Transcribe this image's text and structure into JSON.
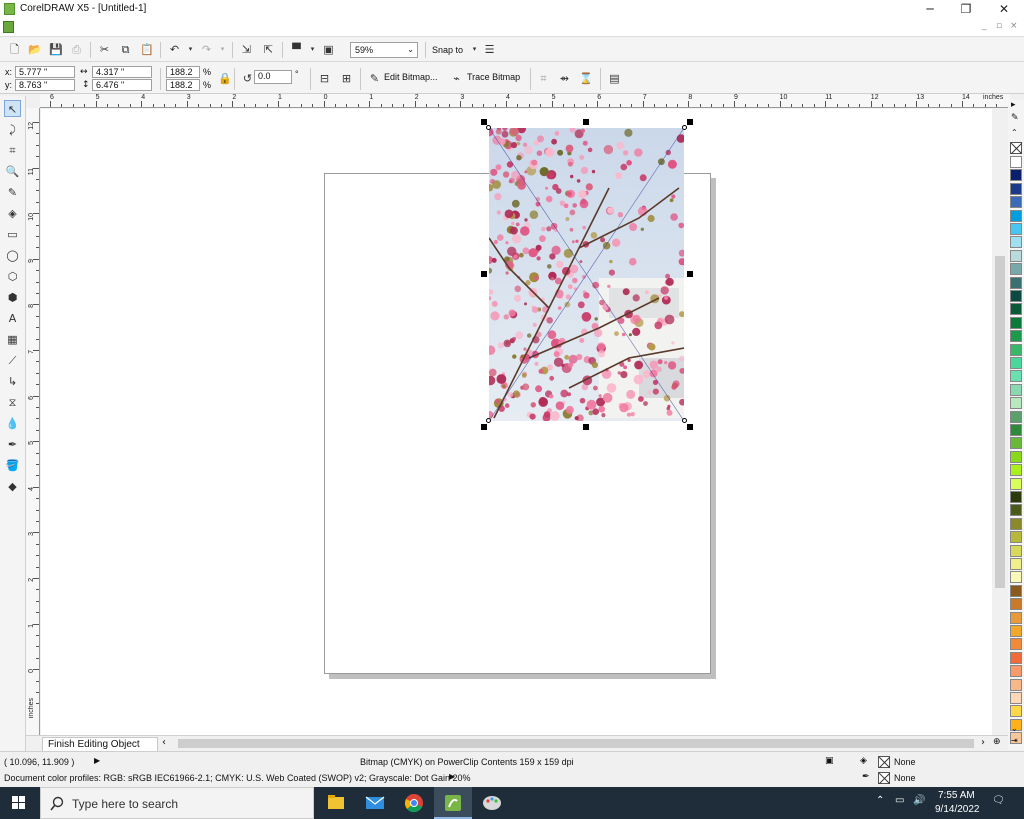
{
  "window": {
    "title": "CorelDRAW X5 - [Untitled-1]",
    "minimize_glyph": "─",
    "restore_glyph": "❐",
    "close_glyph": "✕"
  },
  "menubar": {
    "min_glyph": "_",
    "restore_glyph": "▫",
    "close_glyph": "×"
  },
  "toolbar": {
    "zoom_value": "59%",
    "snap_label": "Snap to"
  },
  "propbar": {
    "x_label": "x:",
    "x_value": "5.777 \"",
    "y_label": "y:",
    "y_value": "8.763 \"",
    "w_value": "4.317 \"",
    "h_value": "6.476 \"",
    "scale_w": "188.2",
    "scale_h": "188.2",
    "pct": "%",
    "rotation": "0.0",
    "deg": "°",
    "edit_bitmap_label": "Edit Bitmap...",
    "trace_bitmap_label": "Trace Bitmap"
  },
  "ruler": {
    "units": "inches",
    "h_labels": [
      "6",
      "5",
      "4",
      "3",
      "2",
      "1",
      "0",
      "1",
      "2",
      "3",
      "4",
      "5",
      "6",
      "7",
      "8",
      "9",
      "10",
      "11",
      "12",
      "13",
      "14"
    ],
    "v_labels": [
      "12",
      "11",
      "10",
      "9",
      "8",
      "7",
      "6",
      "5",
      "4",
      "3",
      "2",
      "1",
      "0"
    ],
    "v_units": "inches"
  },
  "doc_tab": {
    "label": "Finish Editing Object"
  },
  "status": {
    "coords": "( 10.096, 11.909 )",
    "object_info": "Bitmap (CMYK) on PowerClip Contents 159 x 159 dpi",
    "fill_none": "None",
    "outline_none": "None",
    "color_profiles": "Document color profiles: RGB: sRGB IEC61966-2.1; CMYK: U.S. Web Coated (SWOP) v2; Grayscale: Dot Gain 20%"
  },
  "palette_colors": [
    "#ffffff",
    "#0a1e6e",
    "#1a3a8a",
    "#3a6ab8",
    "#00a0e0",
    "#46c6f0",
    "#9ee0f0",
    "#b8dada",
    "#78a8a8",
    "#3a7070",
    "#0a4a40",
    "#0a5a3a",
    "#0a7a3a",
    "#1a9a4a",
    "#3ab86a",
    "#4ad89a",
    "#6ae0b0",
    "#8ad8b0",
    "#b8e8c0",
    "#5aa06a",
    "#2e8a3a",
    "#6ab83a",
    "#8ad81a",
    "#aaf01a",
    "#d8ff5a",
    "#2a3a0a",
    "#4a5a1a",
    "#8a8a2a",
    "#b8b83a",
    "#d8d85a",
    "#f0f08a",
    "#fafab8",
    "#8a5a1a",
    "#c87a2a",
    "#e89a3a",
    "#f0a82a",
    "#f08a3a",
    "#f06a3a",
    "#f89a6a",
    "#f8b88a",
    "#fad8b8",
    "#ffd84a",
    "#ffb01a",
    "#f8c89a"
  ],
  "taskbar": {
    "search_placeholder": "Type here to search",
    "time": "7:55 AM",
    "date": "9/14/2022"
  }
}
